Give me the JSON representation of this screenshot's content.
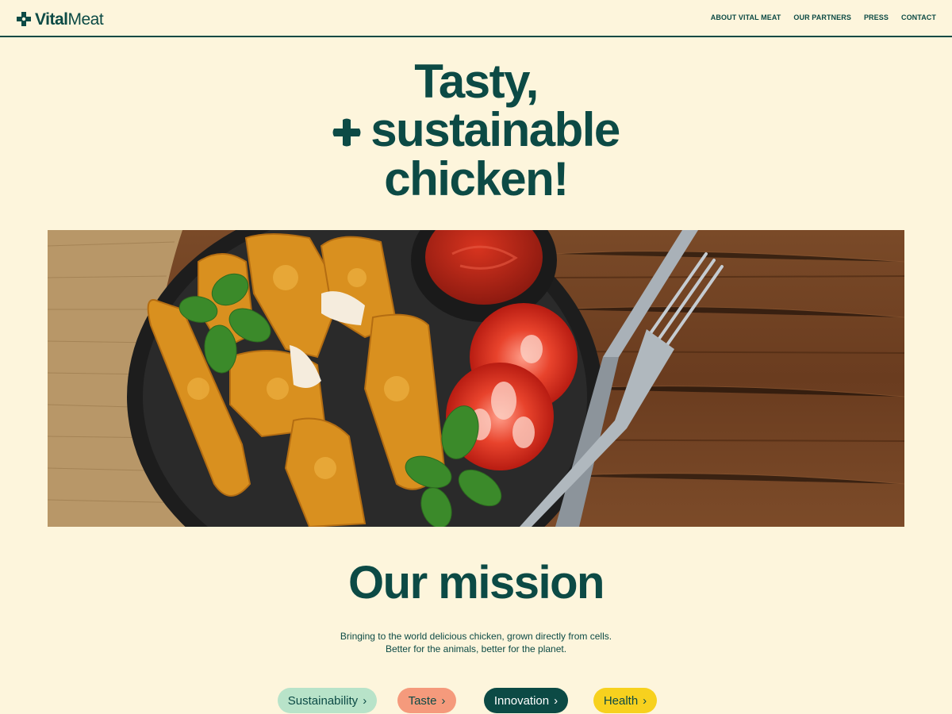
{
  "header": {
    "logo": {
      "bold": "Vital",
      "regular": "Meat"
    },
    "nav": [
      "ABOUT VITAL MEAT",
      "OUR PARTNERS",
      "PRESS",
      "CONTACT"
    ]
  },
  "hero": {
    "line1": "Tasty,",
    "line2": "sustainable",
    "line3": "chicken!",
    "image_alt": "Plate of breaded chicken tenders with ketchup, tomato slices and basil"
  },
  "mission": {
    "title": "Our mission",
    "text": "Bringing to the world delicious chicken, grown directly from cells. Better for the animals, better for the planet."
  },
  "pills": [
    {
      "label": "Sustainability",
      "chevron": "›",
      "bg": "#b8e3c9",
      "fg": "#0c4a45"
    },
    {
      "label": "Taste",
      "chevron": "›",
      "bg": "#f59a7c",
      "fg": "#0c4a45"
    },
    {
      "label": "Innovation",
      "chevron": "›",
      "bg": "#0c4a45",
      "fg": "#ffffff"
    },
    {
      "label": "Health",
      "chevron": "›",
      "bg": "#f7d11e",
      "fg": "#0c4a45"
    }
  ],
  "colors": {
    "brand": "#0c4a45",
    "background": "#fdf5dc"
  }
}
